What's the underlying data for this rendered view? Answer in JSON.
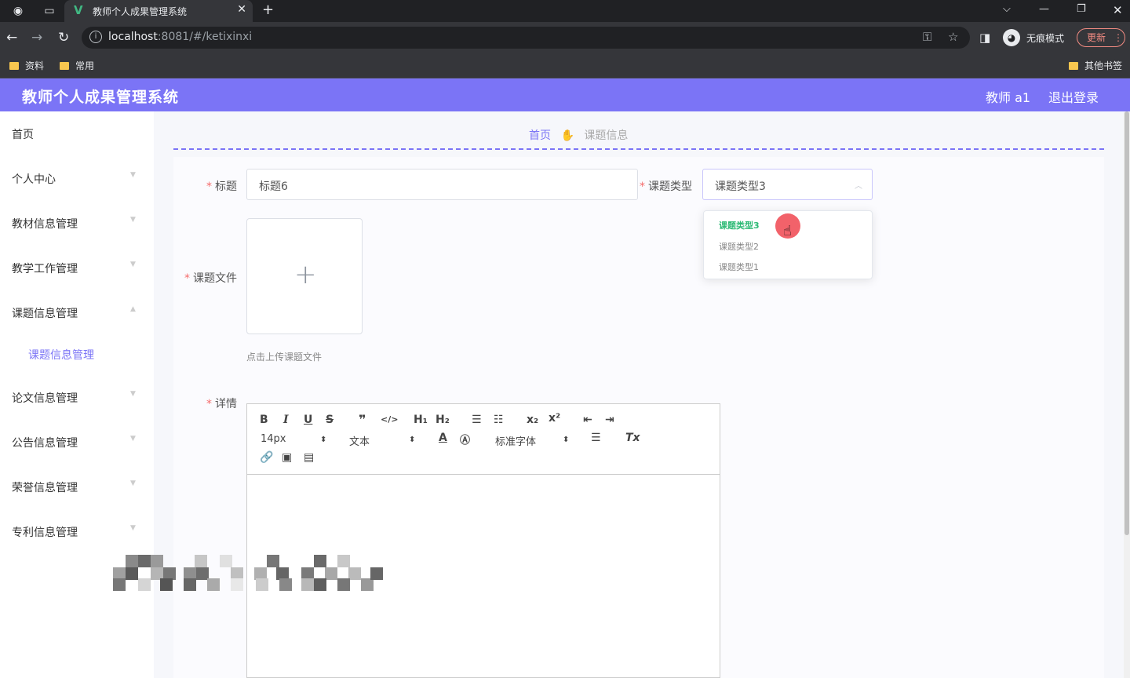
{
  "browser": {
    "tab_title": "教师个人成果管理系统",
    "url_host": "localhost",
    "url_rest": ":8081/#/ketixinxi",
    "incognito_label": "无痕模式",
    "update_label": "更新",
    "bookmarks": [
      "资料",
      "常用"
    ],
    "other_bookmarks": "其他书签"
  },
  "app": {
    "title": "教师个人成果管理系统",
    "user": "教师 a1",
    "logout": "退出登录"
  },
  "sidebar": {
    "items": [
      "首页",
      "个人中心",
      "教材信息管理",
      "教学工作管理",
      "课题信息管理",
      "论文信息管理",
      "公告信息管理",
      "荣誉信息管理",
      "专利信息管理"
    ],
    "active_submenu": "课题信息管理"
  },
  "breadcrumb": {
    "home": "首页",
    "current": "课题信息"
  },
  "form": {
    "title_label": "标题",
    "title_value": "标题6",
    "type_label": "课题类型",
    "type_value": "课题类型3",
    "type_options": [
      "课题类型3",
      "课题类型2",
      "课题类型1"
    ],
    "file_label": "课题文件",
    "file_hint": "点击上传课题文件",
    "detail_label": "详情"
  },
  "editor": {
    "font_size": "14px",
    "header_select": "文本",
    "font_family": "标准字体"
  },
  "colors": {
    "accent": "#7b74f6",
    "selected_option": "#2dba75",
    "required": "#f56c6c"
  }
}
